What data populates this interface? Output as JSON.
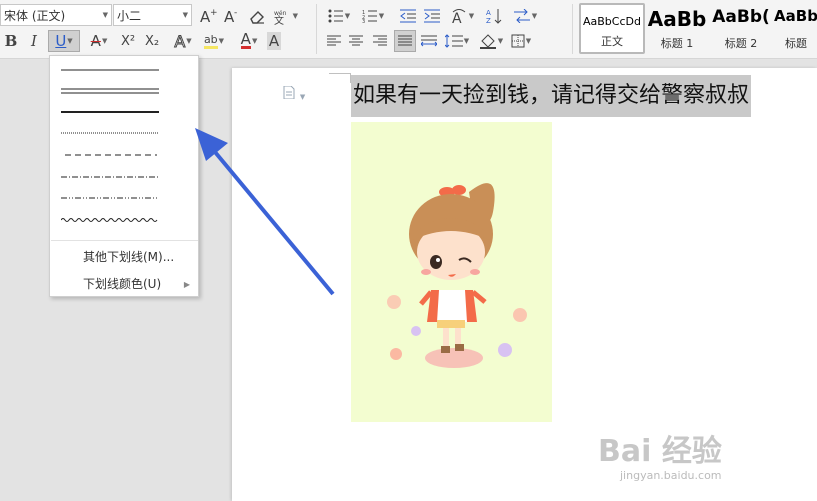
{
  "toolbar": {
    "font_name": "宋体 (正文)",
    "font_size": "小二",
    "grow_font_icon": "A⁺",
    "shrink_font_icon": "A⁻",
    "clear_format_icon": "eraser-icon",
    "phonetic_label": "wén",
    "bold": "B",
    "italic": "I",
    "underline": "U",
    "strike": "A",
    "superscript": "X²",
    "subscript": "X₂",
    "text_effect": "A",
    "highlight": "ab",
    "font_color": "A",
    "char_shading": "A",
    "font_color_hex": "#d32f2f",
    "highlight_hex": "#f5e663"
  },
  "styles": {
    "items": [
      {
        "preview": "AaBbCcDd",
        "name": "正文"
      },
      {
        "preview": "AaBb",
        "name": "标题 1"
      },
      {
        "preview": "AaBb(",
        "name": "标题 2"
      },
      {
        "preview": "AaBb",
        "name": "标题"
      }
    ]
  },
  "underline_menu": {
    "line_styles": [
      "single",
      "double",
      "thick",
      "dotted",
      "dashed",
      "dash-dot",
      "dash-dot-dot",
      "wave"
    ],
    "more_underlines": "其他下划线(M)...",
    "underline_color": "下划线颜色(U)"
  },
  "document": {
    "text": "如果有一天捡到钱，请记得交给警察叔叔",
    "image_bg_hex": "#f3fdd0"
  },
  "watermark": {
    "title": "Bai 经验",
    "url": "jingyan.baidu.com"
  },
  "annotation": {
    "arrow_color_hex": "#3b62d6"
  }
}
